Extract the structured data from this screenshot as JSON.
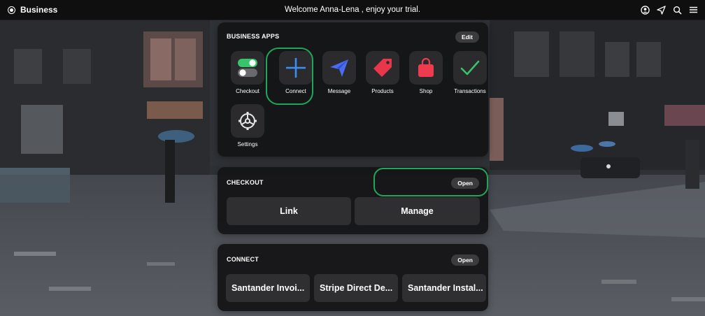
{
  "topbar": {
    "brand": "Business",
    "welcome": "Welcome Anna-Lena , enjoy your trial."
  },
  "icons": {
    "brand": "circle-dot-icon",
    "account": "user-circle-icon",
    "send": "paper-plane-icon",
    "search": "search-icon",
    "menu": "hamburger-menu-icon"
  },
  "apps_card": {
    "title": "BUSINESS APPS",
    "edit_label": "Edit",
    "apps": [
      {
        "label": "Checkout",
        "icon": "toggle-switches-icon"
      },
      {
        "label": "Connect",
        "icon": "plus-icon"
      },
      {
        "label": "Message",
        "icon": "paper-plane-icon"
      },
      {
        "label": "Products",
        "icon": "price-tag-icon"
      },
      {
        "label": "Shop",
        "icon": "shopping-bag-icon"
      },
      {
        "label": "Transactions",
        "icon": "checkmark-icon"
      },
      {
        "label": "Settings",
        "icon": "gear-icon"
      }
    ]
  },
  "checkout_card": {
    "title": "CHECKOUT",
    "open_label": "Open",
    "buttons": [
      "Link",
      "Manage"
    ]
  },
  "connect_card": {
    "title": "CONNECT",
    "open_label": "Open",
    "buttons": [
      "Santander Invoi...",
      "Stripe Direct De...",
      "Santander Instal..."
    ]
  },
  "colors": {
    "topbar": "#0f0f10",
    "card": "#141416",
    "tile": "#2b2b2e",
    "highlight": "#1fa65a",
    "connect_plus": "#3d8ef0",
    "message_plane": "#4a6cf0",
    "products_tag": "#e8374a",
    "shop_bag": "#ef3b4e",
    "transactions_check": "#37c26b"
  }
}
